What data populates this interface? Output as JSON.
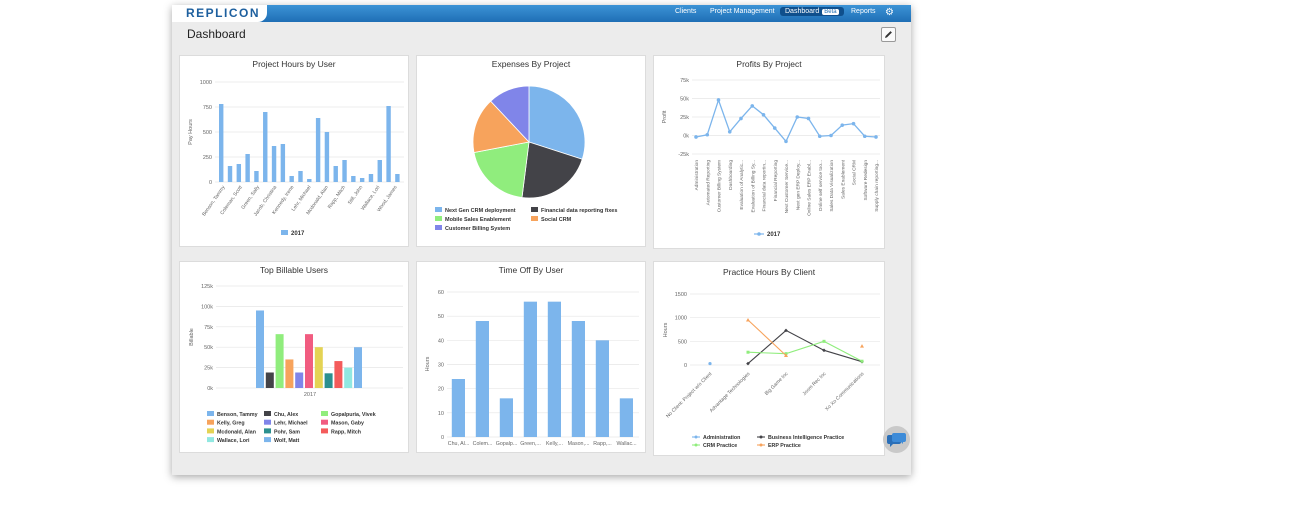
{
  "app": {
    "logo": "REPLICON",
    "nav": [
      "Clients",
      "Project Management",
      "Dashboard",
      "Reports"
    ],
    "beta": "Beta",
    "page_title": "Dashboard"
  },
  "colors": {
    "blue": "#7cb5ec",
    "dark": "#434348",
    "green": "#90ed7d",
    "orange": "#f7a35c",
    "purple": "#8085e9",
    "pink": "#f15c80",
    "yellow": "#e4d354",
    "teal": "#2b908f",
    "red": "#f45b5b",
    "cyan": "#91e8e1"
  },
  "chart_data": [
    {
      "type": "bar",
      "title": "Project Hours by User",
      "ylabel": "Pay Hours",
      "ylim": [
        0,
        1000
      ],
      "yticks": [
        0,
        250,
        500,
        750,
        1000
      ],
      "x_labels": [
        "Benson, Tammy",
        "Coleman, Scott",
        "Green, Sally",
        "Jacob, Christina",
        "Kennedy, Irene",
        "Lehr, Michael",
        "Mcdonald, Alan",
        "Rapp, Mitch",
        "Still, John",
        "Wallace, Lori",
        "Wood, James"
      ],
      "values": [
        780,
        160,
        180,
        280,
        110,
        700,
        360,
        380,
        60,
        110,
        30,
        640,
        500,
        160,
        220,
        60,
        40,
        80,
        220,
        760,
        80
      ],
      "legend": [
        "2017"
      ]
    },
    {
      "type": "pie",
      "title": "Expenses By Project",
      "slices": [
        {
          "name": "Next Gen CRM deployment",
          "value": 30,
          "color": "#7cb5ec"
        },
        {
          "name": "Financial data reporting fixes",
          "value": 22,
          "color": "#434348"
        },
        {
          "name": "Mobile Sales Enablement",
          "value": 20,
          "color": "#90ed7d"
        },
        {
          "name": "Social CRM",
          "value": 16,
          "color": "#f7a35c"
        },
        {
          "name": "Customer Billing System",
          "value": 12,
          "color": "#8085e9"
        }
      ]
    },
    {
      "type": "line",
      "title": "Profits By Project",
      "ylabel": "Profit",
      "ylim": [
        -25000,
        75000
      ],
      "yticks": [
        "-25k",
        "0k",
        "25k",
        "50k",
        "75k"
      ],
      "categories": [
        "Administration",
        "Automated Reporting",
        "Customer Billing System",
        "Dashboarding",
        "Evaluation of Analytic...",
        "Evaluation of Billing Sy...",
        "Financial data reportin...",
        "Financial Reporting",
        "Next Customer Service...",
        "Next gen ERP Deploy...",
        "Online Sales ERP Enabl...",
        "Online self service too...",
        "Sales Data Visualization",
        "Sales Enablement",
        "Social CRM",
        "Software Redesign",
        "Supply chain reporting..."
      ],
      "series": [
        {
          "name": "2017",
          "values": [
            -2000,
            1000,
            48000,
            5000,
            23000,
            40000,
            28000,
            10000,
            -8000,
            25000,
            23000,
            -1000,
            0,
            14000,
            16000,
            -1000,
            -2000
          ]
        }
      ]
    },
    {
      "type": "bar",
      "title": "Top Billable Users",
      "ylabel": "Billable",
      "ylim": [
        0,
        125000
      ],
      "yticks": [
        "0k",
        "25k",
        "50k",
        "75k",
        "100k",
        "125k"
      ],
      "x_labels": [
        "2017"
      ],
      "series": [
        {
          "name": "Benson, Tammy",
          "value": 95000,
          "color": "#7cb5ec"
        },
        {
          "name": "Chu, Alex",
          "value": 19000,
          "color": "#434348"
        },
        {
          "name": "Gopalpuria, Vivek",
          "value": 66000,
          "color": "#90ed7d"
        },
        {
          "name": "Kelly, Greg",
          "value": 35000,
          "color": "#f7a35c"
        },
        {
          "name": "Lehr, Michael",
          "value": 19000,
          "color": "#8085e9"
        },
        {
          "name": "Mason, Gaby",
          "value": 66000,
          "color": "#f15c80"
        },
        {
          "name": "Mcdonald, Alan",
          "value": 50000,
          "color": "#e4d354"
        },
        {
          "name": "Pohr, Sam",
          "value": 18000,
          "color": "#2b908f"
        },
        {
          "name": "Rapp, Mitch",
          "value": 33000,
          "color": "#f45b5b"
        },
        {
          "name": "Wallace, Lori",
          "value": 25000,
          "color": "#91e8e1"
        },
        {
          "name": "Wolf, Matt",
          "value": 50000,
          "color": "#7cb5ec"
        }
      ]
    },
    {
      "type": "bar",
      "title": "Time Off By User",
      "ylabel": "Hours",
      "ylim": [
        0,
        60
      ],
      "yticks": [
        0,
        10,
        20,
        30,
        40,
        50,
        60
      ],
      "categories": [
        "Chu, Al...",
        "Colem...",
        "Gopalp...",
        "Green,...",
        "Kelly,...",
        "Mason,...",
        "Rapp,...",
        "Wallac..."
      ],
      "values": [
        24,
        48,
        16,
        56,
        56,
        48,
        40,
        16
      ]
    },
    {
      "type": "line",
      "title": "Practice Hours By Client",
      "ylabel": "Hours",
      "ylim": [
        0,
        1500
      ],
      "yticks": [
        0,
        500,
        1000,
        1500
      ],
      "categories": [
        "No Client: Project w/o Client",
        "Advantage Technologies",
        "Big Game Inc",
        "Joom Rec Inc",
        "Xo Xo Communications"
      ],
      "series": [
        {
          "name": "Administration",
          "values": [
            30,
            null,
            null,
            null,
            null
          ],
          "color": "#7cb5ec"
        },
        {
          "name": "Business Intelligence Practice",
          "values": [
            null,
            30,
            730,
            310,
            70
          ],
          "color": "#434348"
        },
        {
          "name": "CRM Practice",
          "values": [
            null,
            270,
            240,
            500,
            80
          ],
          "color": "#90ed7d"
        },
        {
          "name": "ERP Practice",
          "values": [
            null,
            950,
            200,
            null,
            400
          ],
          "color": "#f7a35c"
        }
      ]
    }
  ]
}
